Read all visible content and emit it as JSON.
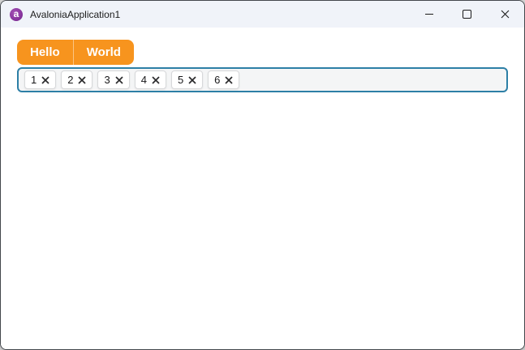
{
  "window": {
    "title": "AvaloniaApplication1",
    "controls": [
      "minimize",
      "maximize",
      "close"
    ]
  },
  "tabs": {
    "items": [
      {
        "label": "Hello"
      },
      {
        "label": "World"
      }
    ]
  },
  "chips": {
    "items": [
      {
        "label": "1"
      },
      {
        "label": "2"
      },
      {
        "label": "3"
      },
      {
        "label": "4"
      },
      {
        "label": "5"
      },
      {
        "label": "6"
      }
    ],
    "remove_icon": "×"
  },
  "colors": {
    "accent": "#F7941E",
    "titlebar_bg": "#F0F3F9",
    "input_border": "#2D7FA6",
    "input_bg": "#F4F5F6"
  }
}
